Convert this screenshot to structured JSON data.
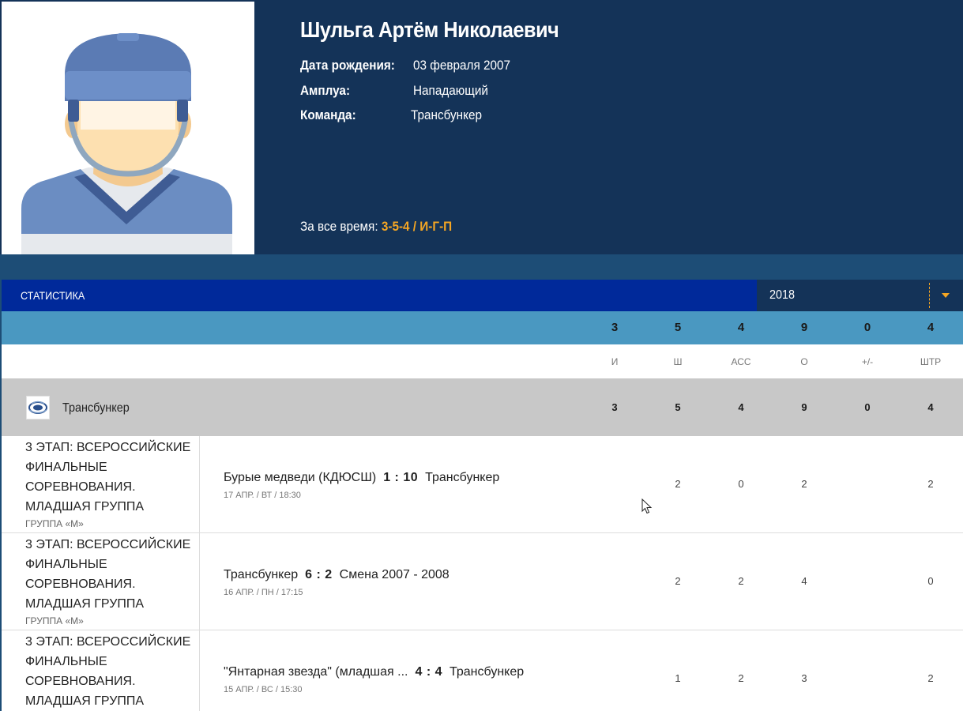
{
  "player": {
    "name": "Шульга Артём Николаевич",
    "birth_label": "Дата рождения:",
    "birth_value": "03 февраля 2007",
    "role_label": "Амплуа:",
    "role_value": "Нападающий",
    "team_label": "Команда:",
    "team_value": "Трансбункер",
    "alltime_label": "За все время:",
    "alltime_value": "3-5-4 / И-Г-П",
    "avatar_icon": "hockey-player-avatar"
  },
  "stats": {
    "title": "СТАТИСТИКА",
    "season": "2018",
    "totals": [
      "3",
      "5",
      "4",
      "9",
      "0",
      "4"
    ],
    "columns": [
      "И",
      "Ш",
      "АСС",
      "О",
      "+/-",
      "ШТР"
    ],
    "team": {
      "name": "Трансбункер",
      "logo_icon": "team-logo-icon",
      "values": [
        "3",
        "5",
        "4",
        "9",
        "0",
        "4"
      ]
    }
  },
  "games": [
    {
      "stage": "3 ЭТАП: ВСЕРОССИЙСКИЕ ФИНАЛЬНЫЕ СОРЕВНОВАНИЯ. МЛАДШАЯ ГРУППА",
      "group": "ГРУППА «М»",
      "home": "Бурые медведи (КДЮСШ)",
      "score": "1 : 10",
      "away": "Трансбункер",
      "date": "17 АПР. / ВТ / 18:30",
      "values": [
        "",
        "2",
        "0",
        "2",
        "",
        "2"
      ]
    },
    {
      "stage": "3 ЭТАП: ВСЕРОССИЙСКИЕ ФИНАЛЬНЫЕ СОРЕВНОВАНИЯ. МЛАДШАЯ ГРУППА",
      "group": "ГРУППА «М»",
      "home": "Трансбункер",
      "score": "6 : 2",
      "away": "Смена 2007 - 2008",
      "date": "16 АПР. / ПН / 17:15",
      "values": [
        "",
        "2",
        "2",
        "4",
        "",
        "0"
      ]
    },
    {
      "stage": "3 ЭТАП: ВСЕРОССИЙСКИЕ ФИНАЛЬНЫЕ СОРЕВНОВАНИЯ. МЛАДШАЯ ГРУППА",
      "group": "",
      "home": "\"Янтарная звезда\" (младшая ...",
      "score": "4 : 4",
      "away": "Трансбункер",
      "date": "15 АПР. / ВС / 15:30",
      "values": [
        "",
        "1",
        "2",
        "3",
        "",
        "2"
      ]
    }
  ],
  "colors": {
    "header_bg": "#143358",
    "stats_bar": "#00299a",
    "totals_bar": "#4a98c1",
    "team_row": "#c8c8c8",
    "accent": "#f5a623"
  }
}
